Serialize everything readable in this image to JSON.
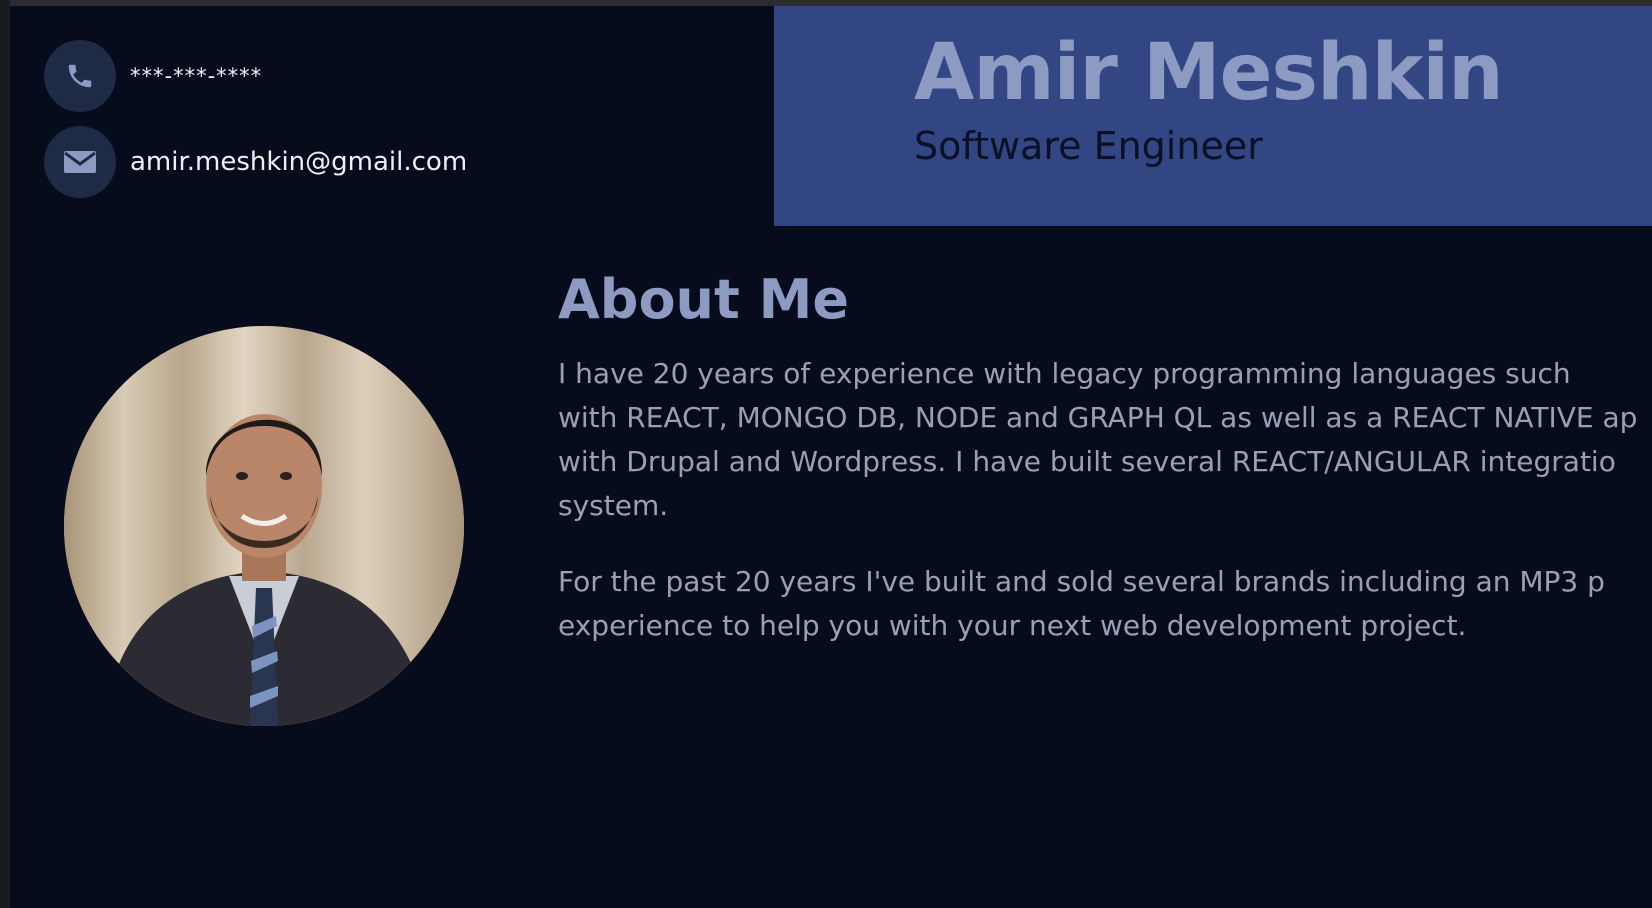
{
  "contact": {
    "phone_icon": "phone-icon",
    "phone": "***-***-****",
    "email_icon": "envelope-icon",
    "email": "amir.meshkin@gmail.com"
  },
  "header": {
    "name": "Amir Meshkin",
    "title": "Software Engineer"
  },
  "photo": {
    "alt": "Profile photo"
  },
  "about": {
    "heading": "About Me",
    "paragraph1_lines": [
      "I have 20 years of experience with legacy programming languages such",
      "with REACT, MONGO DB, NODE and GRAPH QL as well as a REACT NATIVE ap",
      "with Drupal and Wordpress. I have built several REACT/ANGULAR integratio",
      "system."
    ],
    "paragraph2_lines": [
      "For the past 20 years I've built and sold several brands including an MP3 p",
      "experience to help you with your next web development project."
    ]
  },
  "colors": {
    "page_bg": "#070c1c",
    "banner_bg": "#324684",
    "name": "#8d9bc2",
    "title": "#0b1026",
    "body_text": "#9aa0b4",
    "icon_bg": "#1f2b45"
  }
}
